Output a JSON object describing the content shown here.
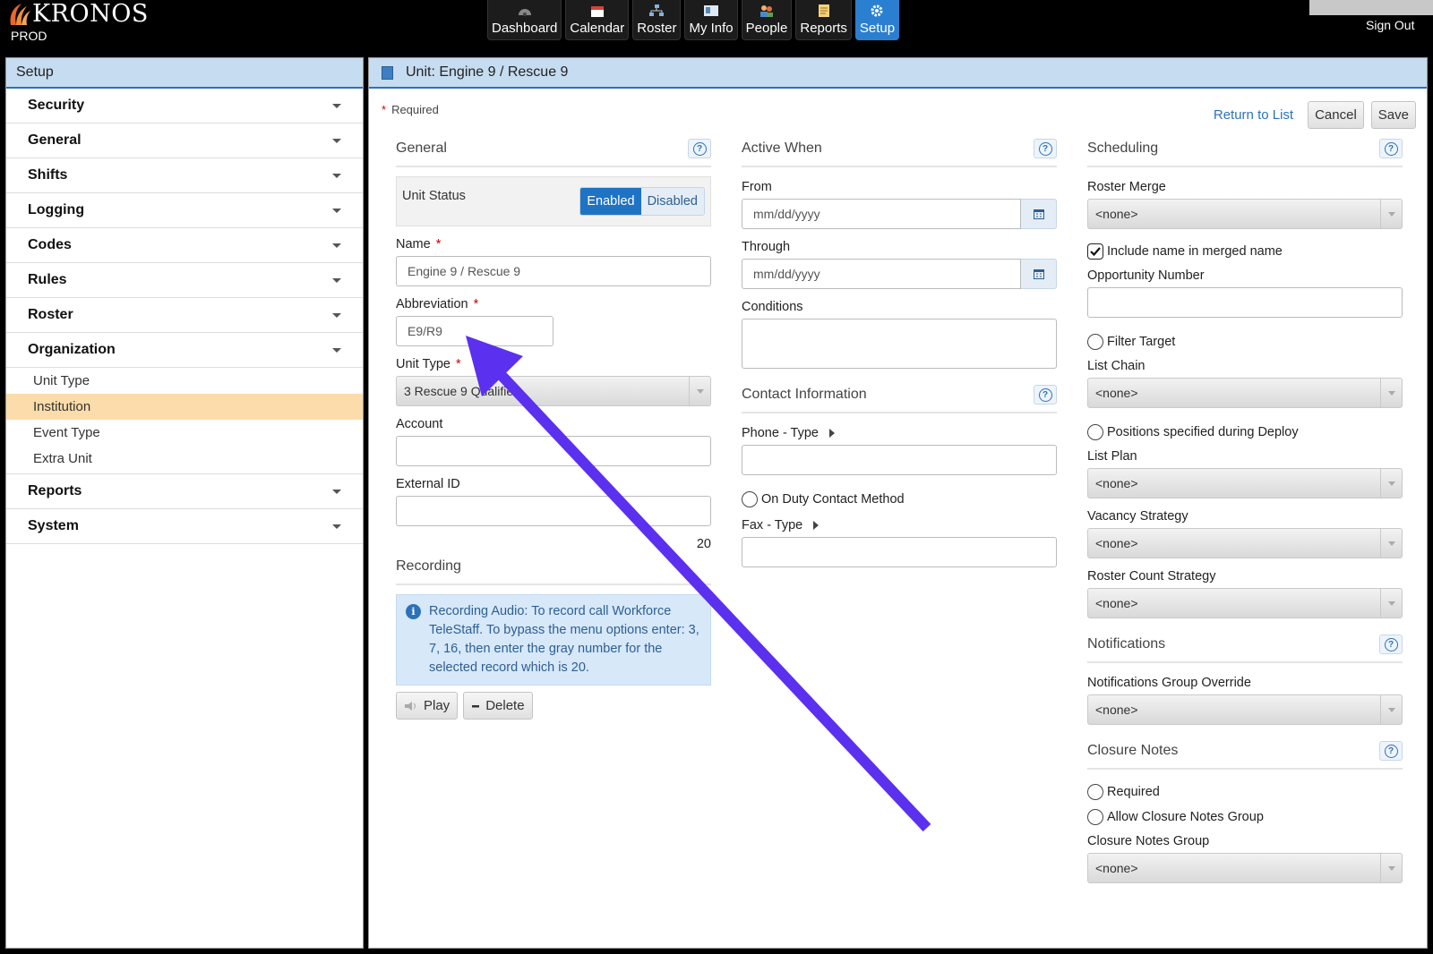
{
  "topbar": {
    "brand": "KRONOS",
    "environment": "PROD",
    "nav": [
      {
        "label": "Dashboard",
        "icon": "dashboard-icon"
      },
      {
        "label": "Calendar",
        "icon": "calendar-icon"
      },
      {
        "label": "Roster",
        "icon": "roster-icon"
      },
      {
        "label": "My Info",
        "icon": "my-info-icon"
      },
      {
        "label": "People",
        "icon": "people-icon"
      },
      {
        "label": "Reports",
        "icon": "reports-icon"
      },
      {
        "label": "Setup",
        "icon": "gear-icon",
        "active": true
      }
    ],
    "sign_out": "Sign Out"
  },
  "sidebar": {
    "title": "Setup",
    "items": [
      {
        "label": "Security"
      },
      {
        "label": "General"
      },
      {
        "label": "Shifts"
      },
      {
        "label": "Logging"
      },
      {
        "label": "Codes"
      },
      {
        "label": "Rules"
      },
      {
        "label": "Roster"
      },
      {
        "label": "Organization",
        "expanded": true
      }
    ],
    "org_sub_items": [
      {
        "label": "Unit Type"
      },
      {
        "label": "Institution",
        "selected": true
      },
      {
        "label": "Event Type"
      },
      {
        "label": "Extra Unit"
      }
    ],
    "items_after": [
      {
        "label": "Reports"
      },
      {
        "label": "System"
      }
    ]
  },
  "main": {
    "title": "Unit: Engine 9 / Rescue 9",
    "required_note": "Required",
    "return_link": "Return to List",
    "cancel": "Cancel",
    "save": "Save",
    "general": {
      "title": "General",
      "unit_status_label": "Unit Status",
      "enabled": "Enabled",
      "disabled": "Disabled",
      "name_label": "Name",
      "name_value": "Engine 9 / Rescue 9",
      "abbr_label": "Abbreviation",
      "abbr_value": "E9/R9",
      "unit_type_label": "Unit Type",
      "unit_type_value": "3 Rescue 9 Qualified",
      "account_label": "Account",
      "external_id_label": "External ID",
      "record_number": "20"
    },
    "recording": {
      "title": "Recording",
      "info": "Recording Audio: To record call Workforce TeleStaff. To bypass the menu options enter: 3, 7, 16, then enter the gray number for the selected record which is 20.",
      "play": "Play",
      "delete": "Delete"
    },
    "active_when": {
      "title": "Active When",
      "from_label": "From",
      "through_label": "Through",
      "date_placeholder": "mm/dd/yyyy",
      "conditions_label": "Conditions"
    },
    "contact": {
      "title": "Contact Information",
      "phone_label": "Phone - Type",
      "on_duty_label": "On Duty Contact Method",
      "fax_label": "Fax - Type"
    },
    "scheduling": {
      "title": "Scheduling",
      "roster_merge_label": "Roster Merge",
      "none": "<none>",
      "include_name_label": "Include name in merged name",
      "opportunity_label": "Opportunity Number",
      "filter_target_label": "Filter Target",
      "list_chain_label": "List Chain",
      "positions_label": "Positions specified during Deploy",
      "list_plan_label": "List Plan",
      "vacancy_label": "Vacancy Strategy",
      "roster_count_label": "Roster Count Strategy"
    },
    "notifications": {
      "title": "Notifications",
      "group_override_label": "Notifications Group Override"
    },
    "closure": {
      "title": "Closure Notes",
      "required_label": "Required",
      "allow_group_label": "Allow Closure Notes Group",
      "group_label": "Closure Notes Group"
    }
  },
  "colors": {
    "accent": "#2a7fd1",
    "panel_header": "#c6dcf0",
    "selected_item": "#fbdcaa",
    "annotation_arrow": "#5b30ef"
  }
}
